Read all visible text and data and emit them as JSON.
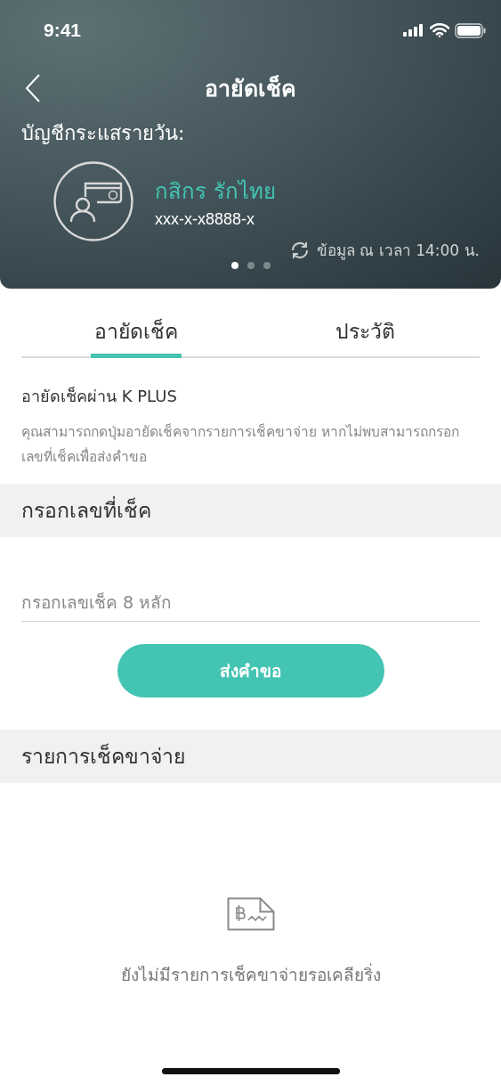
{
  "status_bar": {
    "time": "9:41"
  },
  "nav": {
    "title": "อายัดเช็ค"
  },
  "account": {
    "label": "บัญชีกระแสรายวัน:",
    "name": "กสิกร รักไทย",
    "number": "xxx-x-x8888-x",
    "updated": "ข้อมูล ณ เวลา 14:00 น."
  },
  "pager": [
    {
      "selected": true
    },
    {
      "selected": false
    },
    {
      "selected": false
    }
  ],
  "tabs": [
    {
      "label": "อายัดเช็ค",
      "selected": true
    },
    {
      "label": "ประวัติ",
      "selected": false
    }
  ],
  "intro": {
    "title": "อายัดเช็คผ่าน K PLUS",
    "description": "คุณสามารถกดปุ่มอายัดเช็คจากรายการเช็คขาจ่าย หากไม่พบสามารถกรอกเลขที่เช็คเพื่อส่งคำขอ"
  },
  "check_number": {
    "heading": "กรอกเลขที่เช็ค",
    "placeholder": "กรอกเลขเช็ค 8 หลัก",
    "button": "ส่งคำขอ"
  },
  "pending": {
    "heading": "รายการเช็คขาจ่าย",
    "empty_text": "ยังไม่มีรายการเช็คขาจ่ายรอเคลียริ่ง"
  }
}
